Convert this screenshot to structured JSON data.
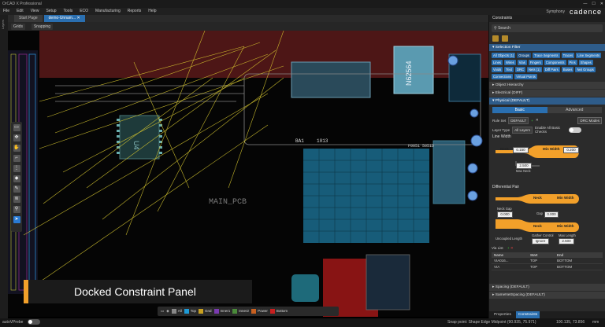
{
  "titlebar": {
    "title": "OrCAD X Professional",
    "min": "—",
    "max": "☐",
    "close": "✕"
  },
  "menu": [
    "File",
    "Edit",
    "View",
    "Setup",
    "Tools",
    "ECO",
    "Manufacturing",
    "Reports",
    "Help"
  ],
  "brand": {
    "symphony": "Symphony",
    "logo": "cadence"
  },
  "tabs": {
    "start": "Start Page",
    "doc": "demo-Unnam...",
    "doc_close": "✕"
  },
  "side_tab": "Layers",
  "toolbar": {
    "grids": "Grids",
    "snapping": "Snapping"
  },
  "board": {
    "label": "MAIN_PCB",
    "u4": "U4",
    "n62564": "N62564",
    "ref_a": "BA1",
    "ref_b": "1013",
    "ref_c": "F0051 5051D"
  },
  "caption": "Docked Constraint Panel",
  "layer_bar": [
    {
      "label": "All",
      "color": "#888888"
    },
    {
      "label": "Top",
      "color": "#1e9ad6"
    },
    {
      "label": "Gnd",
      "color": "#c8a020"
    },
    {
      "label": "Inner1",
      "color": "#7a3ab0"
    },
    {
      "label": "Inner2",
      "color": "#4a8a3a"
    },
    {
      "label": "Power",
      "color": "#c86020"
    },
    {
      "label": "Bottom",
      "color": "#c82020"
    }
  ],
  "status": {
    "toggle_label": "autoVPrebe",
    "snap": "Snap point: Shape Edge Midpoint (90.935, 75.971)",
    "coords": "100.135, 73.856",
    "unit": "mm"
  },
  "panel": {
    "title": "Constraints",
    "search": "Search",
    "selection_filter": "Selection Filter",
    "chips": [
      "All Objects (1)",
      "Groups",
      "Trace Segments",
      "Traces",
      "Line Segments",
      "Lines",
      "Wires",
      "Vias",
      "Fingers",
      "Components",
      "Pins",
      "Shapes",
      "Voids",
      "Text",
      "DRC",
      "Nets (1)",
      "Diff Pairs",
      "Buses",
      "Net Groups",
      "Connections",
      "Virtual Points"
    ],
    "object_hierarchy": "Object Hierarchy",
    "electrical": "Electrical (DIFF)",
    "physical": "Physical (DEFAULT)",
    "mode_basic": "Basic",
    "mode_advanced": "Advanced",
    "rule_set_label": "Rule Set",
    "rule_set_value": "DEFAULT",
    "drc_modes": "DRC Modes",
    "layer_type_label": "Layer Type",
    "layer_type_value": "All Layers",
    "enable_checks": "Enable All Basic Checks",
    "line_width": {
      "title": "Line Width",
      "neck_label": "Neck",
      "neck_value": "0.150",
      "min_label": "Min Width",
      "min_value": "0.200",
      "max_neck_value": "2.500",
      "max_neck_label": "Max Neck"
    },
    "diff_pair": {
      "title": "Differential Pair",
      "neck": "Neck",
      "min_width": "Min Width",
      "neck_gap_label": "Neck Gap",
      "neck_gap": "0.000",
      "gap_label": "Gap",
      "gap": "0.000",
      "uncoupled_label": "Uncoupled  Length",
      "gather_label": "Gather Control",
      "gather_value": "Ignore",
      "max_length_label": "Max Length",
      "max_length": "2.500"
    },
    "via_list": {
      "title": "Via List",
      "headers": [
        "Name",
        "Start",
        "End"
      ],
      "rows": [
        {
          "name": "VIA016...",
          "start": "TOP",
          "end": "BOTTOM"
        },
        {
          "name": "VIA",
          "start": "TOP",
          "end": "BOTTOM"
        }
      ]
    },
    "spacing": "Spacing (DEFAULT)",
    "same_net": "SameNetSpacing (DEFAULT)",
    "bottom_tabs": [
      "Properties",
      "Constraints"
    ]
  }
}
